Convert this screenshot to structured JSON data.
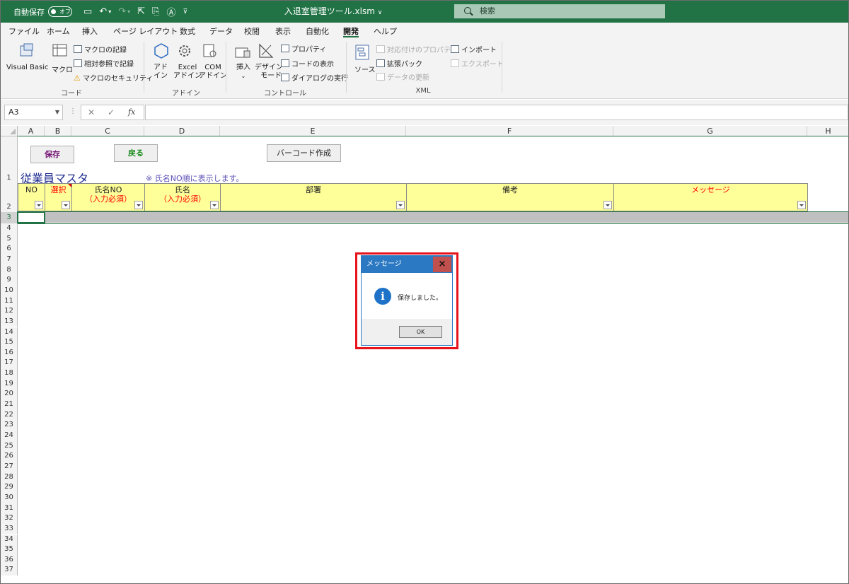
{
  "titlebar": {
    "autosave_label": "自動保存",
    "autosave_state": "オフ",
    "document_title": "入退室管理ツール.xlsm",
    "search_placeholder": "検索"
  },
  "menu": {
    "tabs": [
      "ファイル",
      "ホーム",
      "挿入",
      "ページ レイアウト",
      "数式",
      "データ",
      "校閲",
      "表示",
      "自動化",
      "開発",
      "ヘルプ"
    ],
    "active_tab": "開発"
  },
  "ribbon": {
    "code": {
      "visual_basic": "Visual Basic",
      "macro": "マクロ",
      "record_macro": "マクロの記録",
      "relative_ref": "相対参照で記録",
      "macro_security": "マクロのセキュリティ",
      "group_label": "コード"
    },
    "addins": {
      "addin_l1": "アド",
      "addin_l2": "イン",
      "excel_addin_l1": "Excel",
      "excel_addin_l2": "アドイン",
      "com_addin_l1": "COM",
      "com_addin_l2": "アドイン",
      "group_label": "アドイン"
    },
    "controls": {
      "insert": "挿入",
      "design_mode_l1": "デザイン",
      "design_mode_l2": "モード",
      "properties": "プロパティ",
      "view_code": "コードの表示",
      "run_dialog": "ダイアログの実行",
      "group_label": "コントロール"
    },
    "xml": {
      "source": "ソース",
      "map_properties": "対応付けのプロパティ",
      "expansion_packs": "拡張パック",
      "refresh_data": "データの更新",
      "import": "インポート",
      "export": "エクスポート",
      "group_label": "XML"
    }
  },
  "formula_bar": {
    "name_box": "A3",
    "fx": "fx",
    "value": ""
  },
  "grid": {
    "columns": [
      "A",
      "B",
      "C",
      "D",
      "E",
      "F",
      "G",
      "H"
    ],
    "rows": [
      "1",
      "2",
      "3",
      "4",
      "5",
      "6",
      "7",
      "8",
      "9",
      "10",
      "11",
      "12",
      "13",
      "14",
      "15",
      "16",
      "17",
      "18",
      "19",
      "20",
      "21",
      "22",
      "23",
      "24",
      "25",
      "26",
      "27",
      "28",
      "29",
      "30",
      "31",
      "32",
      "33",
      "34",
      "35",
      "36",
      "37"
    ]
  },
  "sheet": {
    "save_button": "保存",
    "back_button": "戻る",
    "barcode_button": "バーコード作成",
    "title": "従業員マスタ",
    "note": "※ 氏名NO順に表示します。",
    "headers": {
      "no": "NO",
      "select": "選択",
      "name_no": "氏名NO",
      "name_no_req": "（入力必須）",
      "name": "氏名",
      "name_req": "（入力必須）",
      "department": "部署",
      "remarks": "備考",
      "message": "メッセージ"
    }
  },
  "dialog": {
    "title": "メッセージ",
    "message": "保存しました。",
    "ok": "OK",
    "close": "×"
  },
  "colors": {
    "excel_green": "#217346",
    "header_fill": "#ffff99",
    "highlight_outline": "#e8121b",
    "dialog_blue": "#2b79c2"
  }
}
